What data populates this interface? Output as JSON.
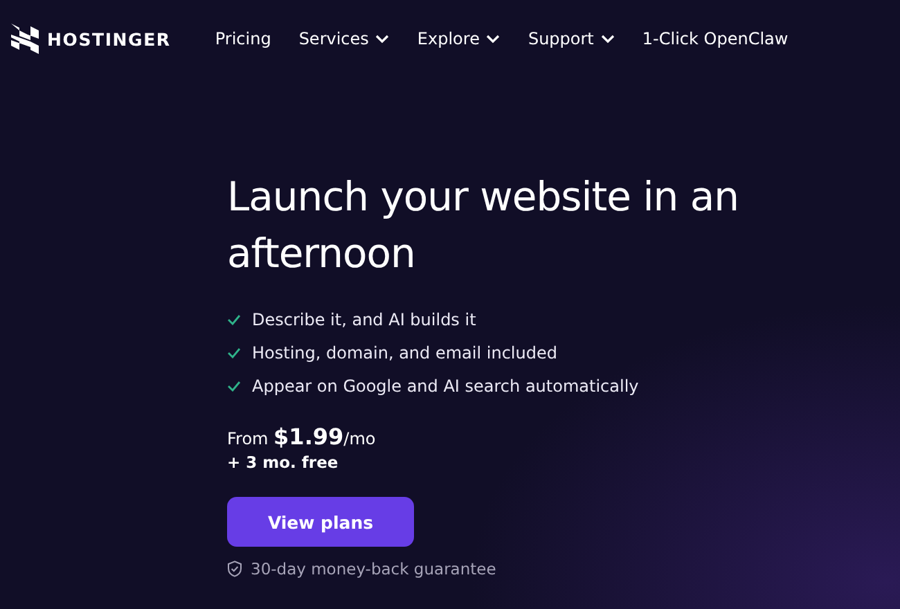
{
  "brand": {
    "name": "HOSTINGER"
  },
  "nav": [
    {
      "label": "Pricing",
      "dropdown": false
    },
    {
      "label": "Services",
      "dropdown": true
    },
    {
      "label": "Explore",
      "dropdown": true
    },
    {
      "label": "Support",
      "dropdown": true
    },
    {
      "label": "1-Click OpenClaw",
      "dropdown": false
    }
  ],
  "hero": {
    "title": "Launch your website in an afternoon",
    "features": [
      "Describe it, and AI builds it",
      "Hosting, domain, and email included",
      "Appear on Google and AI search automatically"
    ],
    "price": "From **$1.99**/mo",
    "bonus": "+ 3 mo. free",
    "cta": "View plans",
    "guarantee": "30-day money-back guarantee"
  }
}
